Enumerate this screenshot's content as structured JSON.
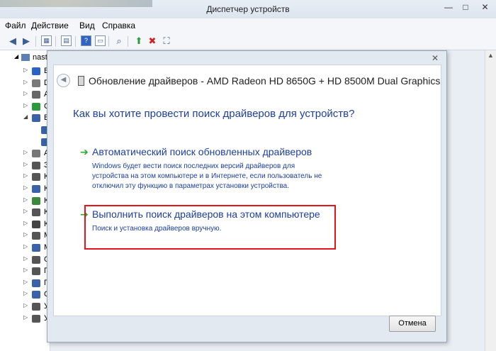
{
  "window": {
    "title": "Диспетчер устройств",
    "controls": [
      "—",
      "□",
      "✕"
    ]
  },
  "menubar": [
    "Файл",
    "Действие",
    "Вид",
    "Справка"
  ],
  "toolbar_icons": [
    "back-icon",
    "forward-icon",
    "properties-icon",
    "show-hidden-icon",
    "help-icon",
    "console-icon",
    "scan-hardware-icon",
    "update-driver-icon",
    "disable-device-icon",
    "uninstall-icon"
  ],
  "tree": {
    "root_label": "nast",
    "rows": [
      {
        "arrow": "▷",
        "letter": "B",
        "color": "#2a63c7"
      },
      {
        "arrow": "▷",
        "letter": "D",
        "color": "#7a7a7a"
      },
      {
        "arrow": "▷",
        "letter": "A",
        "color": "#666"
      },
      {
        "arrow": "▷",
        "letter": "C",
        "color": "#2a9a3a"
      },
      {
        "arrow": "◢",
        "letter": "B",
        "color": "#3a62a8"
      },
      {
        "arrow": "",
        "letter": "",
        "color": "#3a62a8"
      },
      {
        "arrow": "",
        "letter": "",
        "color": "#3a62a8"
      },
      {
        "arrow": "▷",
        "letter": "A",
        "color": "#777"
      },
      {
        "arrow": "▷",
        "letter": "З",
        "color": "#555"
      },
      {
        "arrow": "▷",
        "letter": "К",
        "color": "#555"
      },
      {
        "arrow": "▷",
        "letter": "К",
        "color": "#3a62a8"
      },
      {
        "arrow": "▷",
        "letter": "К",
        "color": "#3a8a3a"
      },
      {
        "arrow": "▷",
        "letter": "К",
        "color": "#555"
      },
      {
        "arrow": "▷",
        "letter": "К",
        "color": "#444"
      },
      {
        "arrow": "▷",
        "letter": "М",
        "color": "#555"
      },
      {
        "arrow": "▷",
        "letter": "М",
        "color": "#3a62a8"
      },
      {
        "arrow": "▷",
        "letter": "О",
        "color": "#555"
      },
      {
        "arrow": "▷",
        "letter": "П",
        "color": "#555"
      },
      {
        "arrow": "▷",
        "letter": "П",
        "color": "#3a62a8"
      },
      {
        "arrow": "▷",
        "letter": "С",
        "color": "#3a62a8"
      },
      {
        "arrow": "▷",
        "letter": "У",
        "color": "#555"
      },
      {
        "arrow": "▷",
        "letter": "У",
        "color": "#555"
      }
    ]
  },
  "dialog": {
    "title": "Обновление драйверов - AMD Radeon HD 8650G + HD 8500M Dual Graphics",
    "question": "Как вы хотите провести поиск драйверов для устройств?",
    "options": [
      {
        "heading": "Автоматический поиск обновленных драйверов",
        "description": "Windows будет вести поиск последних версий драйверов для устройства на этом компьютере и в Интернете, если пользователь не отключил эту функцию в параметрах установки устройства."
      },
      {
        "heading": "Выполнить поиск драйверов на этом компьютере",
        "description": "Поиск и установка драйверов вручную."
      }
    ],
    "cancel_label": "Отмена",
    "highlight_color": "#e2141c"
  }
}
